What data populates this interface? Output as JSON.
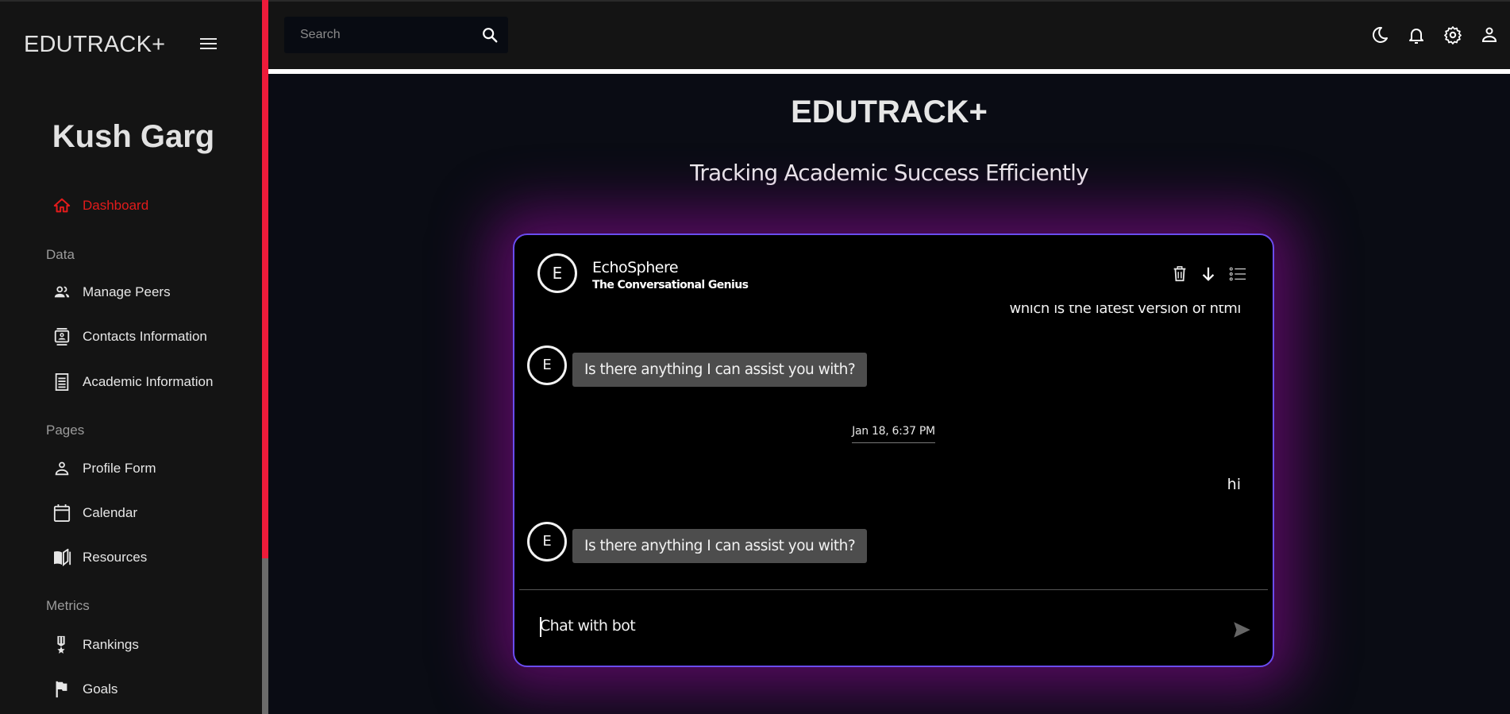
{
  "app": {
    "brand": "EDUTRACK+",
    "user_name": "Kush Garg"
  },
  "sidebar": {
    "items": [
      {
        "label": "Dashboard",
        "icon": "home-icon",
        "active": true
      },
      {
        "label": "Manage Peers",
        "icon": "people-icon"
      },
      {
        "label": "Contacts Information",
        "icon": "contact-card-icon"
      },
      {
        "label": "Academic Information",
        "icon": "receipt-icon"
      },
      {
        "label": "Profile Form",
        "icon": "person-icon"
      },
      {
        "label": "Calendar",
        "icon": "calendar-icon"
      },
      {
        "label": "Resources",
        "icon": "book-icon"
      },
      {
        "label": "Rankings",
        "icon": "medal-icon"
      },
      {
        "label": "Goals",
        "icon": "flag-icon"
      }
    ],
    "sections": [
      "Data",
      "Pages",
      "Metrics"
    ]
  },
  "topbar": {
    "search_placeholder": "Search",
    "icons": [
      "moon-icon",
      "bell-icon",
      "gear-icon",
      "user-icon"
    ]
  },
  "main": {
    "title": "EDUTRACK+",
    "subtitle": "Tracking Academic Success Efficiently"
  },
  "chat": {
    "bot_initial": "E",
    "bot_name": "EchoSphere",
    "bot_tagline": "The Conversational Genius",
    "actions": [
      "trash-icon",
      "download-arrow-icon",
      "list-icon"
    ],
    "messages": [
      {
        "from": "user",
        "text": "which is the latest version of html"
      },
      {
        "from": "bot",
        "text": "Is there anything I can assist you with?"
      },
      {
        "type": "date",
        "text": "Jan 18, 6:37 PM"
      },
      {
        "from": "user",
        "text": "hi"
      },
      {
        "from": "bot",
        "text": "Is there anything I can assist you with?"
      }
    ],
    "input_placeholder": "Chat with bot"
  },
  "colors": {
    "accent_red": "#ee1b3a",
    "active_nav": "#e21b1b",
    "chat_border": "#6a4cf0",
    "glow": "#6e0a78"
  }
}
